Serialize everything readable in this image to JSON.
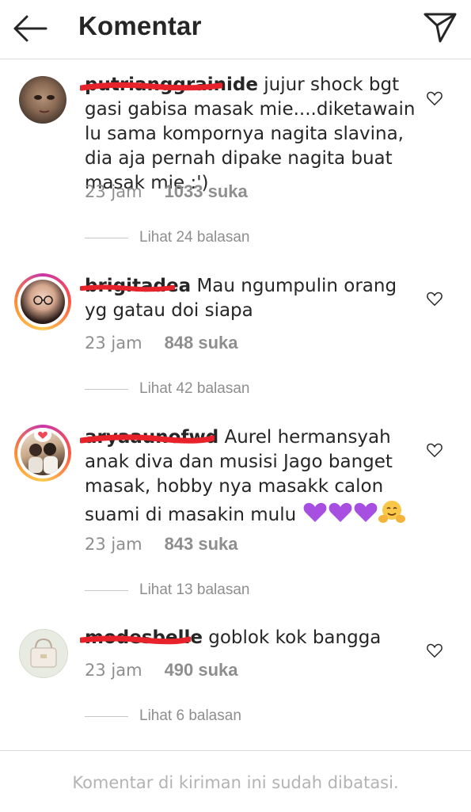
{
  "header": {
    "title": "Komentar"
  },
  "comments": [
    {
      "username": "putrianggrainide",
      "text": " jujur shock bgt gasi gabisa masak mie....diketawain lu sama kompornya nagita slavina, dia aja pernah dipake nagita buat masak mie :')",
      "time": "23 jam",
      "likes": "1033 suka",
      "replies": "Lihat 24 balasan"
    },
    {
      "username": "brigitadea",
      "text": " Mau ngumpulin orang yg gatau doi siapa",
      "time": "23 jam",
      "likes": "848 suka",
      "replies": "Lihat 42 balasan"
    },
    {
      "username": "aryaaunofwd",
      "text": " Aurel hermansyah anak diva dan musisi Jago banget masak, hobby nya masakk calon suami di masakin mulu",
      "emojis": [
        "purple-heart",
        "purple-heart",
        "purple-heart",
        "hugging-face"
      ],
      "time": "23 jam",
      "likes": "843 suka",
      "replies": "Lihat 13 balasan"
    },
    {
      "username": "modesbelle",
      "text": " goblok kok bangga",
      "time": "23 jam",
      "likes": "490 suka",
      "replies": "Lihat 6 balasan"
    }
  ],
  "footer": {
    "notice": "Komentar di kiriman ini sudah dibatasi."
  },
  "colors": {
    "strike": "#e8222a",
    "muted": "#8e8e8e",
    "divider": "#dbdbdb"
  }
}
